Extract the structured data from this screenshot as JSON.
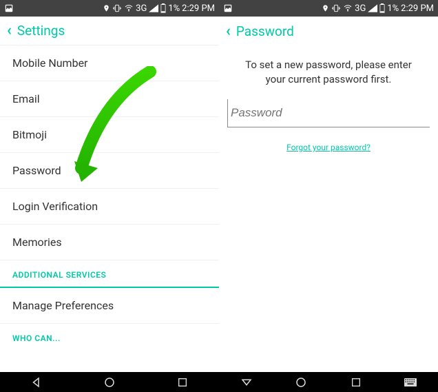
{
  "status_bar": {
    "signal_label": "3G",
    "battery_pct": "1%",
    "time": "2:29 PM"
  },
  "left_screen": {
    "header_title": "Settings",
    "items": [
      "Mobile Number",
      "Email",
      "Bitmoji",
      "Password",
      "Login Verification",
      "Memories"
    ],
    "section1_label": "ADDITIONAL SERVICES",
    "section1_item": "Manage Preferences",
    "section2_label": "WHO CAN..."
  },
  "right_screen": {
    "header_title": "Password",
    "instruction": "To set a new password, please enter your current password first.",
    "password_placeholder": "Password",
    "forgot_link": "Forgot your password?"
  }
}
